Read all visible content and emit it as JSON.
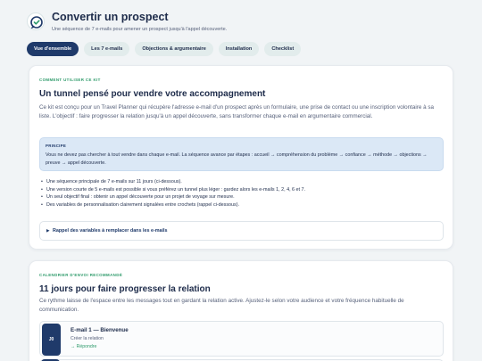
{
  "header": {
    "title": "Convertir un prospect",
    "subtitle": "Une séquence de 7 e-mails pour amener un prospect jusqu'à l'appel découverte.",
    "logo_icon": "chat-check-logo",
    "brand_color": "#1f3a6a",
    "accent_color": "#2d9a6a"
  },
  "tabs": [
    {
      "label": "Vue d'ensemble",
      "active": true
    },
    {
      "label": "Les 7 e-mails",
      "active": false
    },
    {
      "label": "Objections & argumentaire",
      "active": false
    },
    {
      "label": "Installation",
      "active": false
    },
    {
      "label": "Checklist",
      "active": false
    }
  ],
  "intro": {
    "eyebrow": "COMMENT UTILISER CE KIT",
    "title": "Un tunnel pensé pour vendre votre accompagnement",
    "description": "Ce kit est conçu pour un Travel Planner qui récupère l'adresse e-mail d'un prospect après un formulaire, une prise de contact ou une inscription volontaire à sa liste. L'objectif : faire progresser la relation jusqu'à un appel découverte, sans transformer chaque e-mail en argumentaire commercial.",
    "principle": {
      "label": "PRINCIPE",
      "text": "Vous ne devez pas chercher à tout vendre dans chaque e-mail. La séquence avance par étapes : accueil → compréhension du problème → confiance → méthode → objections → preuve → appel découverte."
    },
    "bullets": [
      "Une séquence principale de 7 e-mails sur 11 jours (ci-dessous).",
      "Une version courte de 5 e-mails est possible si vous préférez un tunnel plus léger : gardez alors les e-mails 1, 2, 4, 6 et 7.",
      "Un seul objectif final : obtenir un appel découverte pour un projet de voyage sur mesure.",
      "Des variables de personnalisation clairement signalées entre crochets (rappel ci-dessous)."
    ],
    "accordion_label": "Rappel des variables à remplacer dans les e-mails"
  },
  "calendar": {
    "eyebrow": "CALENDRIER D'ENVOI RECOMMANDÉ",
    "title": "11 jours pour faire progresser la relation",
    "description": "Ce rythme laisse de l'espace entre les messages tout en gardant la relation active. Ajustez-le selon votre audience et votre fréquence habituelle de communication.",
    "emails": [
      {
        "day": "J0",
        "title": "E-mail 1 — Bienvenue",
        "desc": "Créer la relation",
        "action": "→ Répondre"
      }
    ]
  }
}
